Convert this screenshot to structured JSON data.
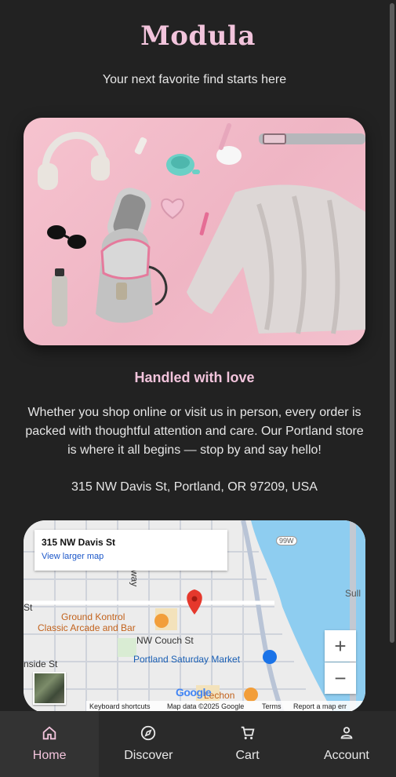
{
  "header": {
    "brand": "Modula",
    "tagline": "Your next favorite find starts here"
  },
  "hero": {
    "image_icon": "product-flatlay-image"
  },
  "about": {
    "title": "Handled with love",
    "body": "Whether you shop online or visit us in person, every order is packed with thoughtful attention and care. Our Portland store is where it all begins — stop by and say hello!",
    "address": "315 NW Davis St, Portland, OR 97209, USA"
  },
  "map": {
    "place_name": "315 NW Davis St",
    "view_larger": "View larger map",
    "zoom_in": "+",
    "zoom_out": "−",
    "labels": {
      "ground_kontrol_1": "Ground Kontrol",
      "ground_kontrol_2": "Classic Arcade and Bar",
      "nw_couch": "NW Couch St",
      "saturday_market": "Portland Saturday Market",
      "lechon": "Lechon",
      "st_left": "St",
      "inside_st": "nside St",
      "broadway": "adway",
      "highway": "99W",
      "sull": "Sull",
      "route5": "5"
    },
    "google": "Google",
    "footer": {
      "shortcuts": "Keyboard shortcuts",
      "map_data": "Map data ©2025 Google",
      "terms": "Terms",
      "report": "Report a map err"
    }
  },
  "nav": {
    "items": [
      {
        "label": "Home",
        "icon": "home-icon",
        "active": true
      },
      {
        "label": "Discover",
        "icon": "compass-icon",
        "active": false
      },
      {
        "label": "Cart",
        "icon": "cart-icon",
        "active": false
      },
      {
        "label": "Account",
        "icon": "person-icon",
        "active": false
      }
    ]
  },
  "colors": {
    "background": "#222222",
    "accent_pink": "#f2c4dc",
    "nav_bg": "#2a2a2a",
    "nav_active_bg": "#333333"
  }
}
